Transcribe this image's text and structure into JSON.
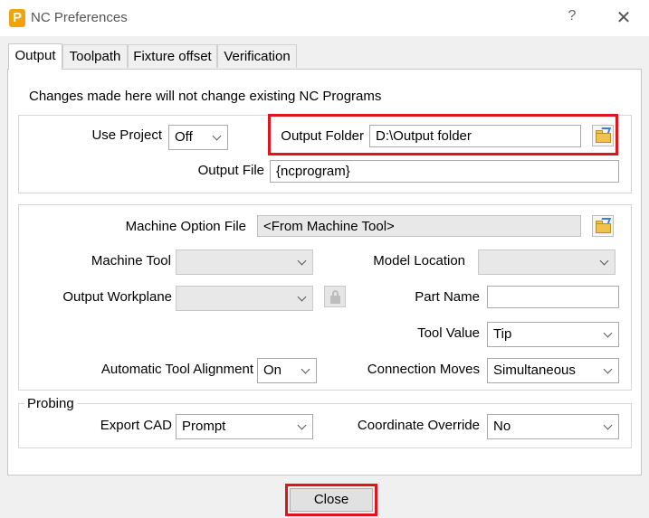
{
  "window": {
    "title": "NC Preferences",
    "app_icon_letter": "P",
    "help_label": "?",
    "close_glyph": "✕"
  },
  "tabs": [
    {
      "label": "Output",
      "active": true
    },
    {
      "label": "Toolpath",
      "active": false
    },
    {
      "label": "Fixture offset",
      "active": false
    },
    {
      "label": "Verification",
      "active": false
    }
  ],
  "output": {
    "notice": "Changes made here will not change existing NC Programs",
    "use_project": {
      "label": "Use Project",
      "value": "Off"
    },
    "output_folder": {
      "label": "Output Folder",
      "value": "D:\\Output folder"
    },
    "output_file": {
      "label": "Output File",
      "value": "{ncprogram}"
    },
    "machine_option_file": {
      "label": "Machine Option File",
      "value": "<From Machine Tool>"
    },
    "machine_tool": {
      "label": "Machine Tool",
      "value": ""
    },
    "model_location": {
      "label": "Model Location",
      "value": ""
    },
    "output_workplane": {
      "label": "Output Workplane",
      "value": ""
    },
    "part_name": {
      "label": "Part Name",
      "value": ""
    },
    "tool_value": {
      "label": "Tool Value",
      "value": "Tip"
    },
    "automatic_tool_alignment": {
      "label": "Automatic Tool Alignment",
      "value": "On"
    },
    "connection_moves": {
      "label": "Connection Moves",
      "value": "Simultaneous"
    }
  },
  "probing": {
    "legend": "Probing",
    "export_cad": {
      "label": "Export CAD",
      "value": "Prompt"
    },
    "coordinate_override": {
      "label": "Coordinate Override",
      "value": "No"
    }
  },
  "footer": {
    "close_label": "Close"
  },
  "colors": {
    "highlight": "#e0151b",
    "folder": "#f1c24b"
  },
  "icons": [
    "folder-open-icon",
    "lock-icon",
    "chevron-down-icon",
    "close-icon",
    "help-icon"
  ]
}
